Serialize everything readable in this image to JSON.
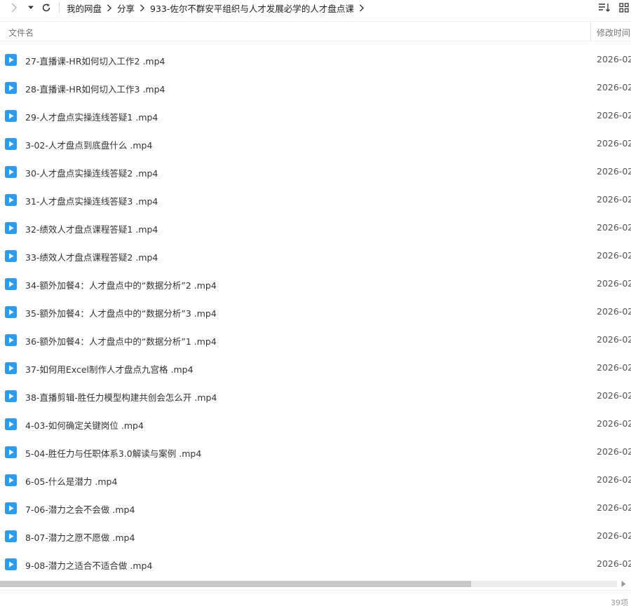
{
  "breadcrumb": {
    "items": [
      {
        "label": "我的网盘"
      },
      {
        "label": "分享"
      },
      {
        "label": "933-佐尔不群安平组织与人才发展必学的人才盘点课"
      }
    ]
  },
  "table": {
    "headers": {
      "name": "文件名",
      "modified": "修改时间"
    },
    "rows": [
      {
        "name": "27-直播课-HR如何切入工作2 .mp4",
        "date": "2026-02-"
      },
      {
        "name": "28-直播课-HR如何切入工作3 .mp4",
        "date": "2026-02-"
      },
      {
        "name": "29-人才盘点实操连线答疑1 .mp4",
        "date": "2026-02-"
      },
      {
        "name": "3-02-人才盘点到底盘什么 .mp4",
        "date": "2026-02-"
      },
      {
        "name": "30-人才盘点实操连线答疑2 .mp4",
        "date": "2026-02-"
      },
      {
        "name": "31-人才盘点实操连线答疑3 .mp4",
        "date": "2026-02-"
      },
      {
        "name": "32-绩效人才盘点课程答疑1 .mp4",
        "date": "2026-02-"
      },
      {
        "name": "33-绩效人才盘点课程答疑2 .mp4",
        "date": "2026-02-"
      },
      {
        "name": "34-额外加餐4：人才盘点中的“数据分析”2 .mp4",
        "date": "2026-02-"
      },
      {
        "name": "35-额外加餐4：人才盘点中的“数据分析”3 .mp4",
        "date": "2026-02-"
      },
      {
        "name": "36-额外加餐4：人才盘点中的“数据分析”1 .mp4",
        "date": "2026-02-"
      },
      {
        "name": "37-如何用Excel制作人才盘点九宫格 .mp4",
        "date": "2026-02-"
      },
      {
        "name": "38-直播剪辑-胜任力模型构建共创会怎么开 .mp4",
        "date": "2026-02-"
      },
      {
        "name": "4-03-如何确定关键岗位 .mp4",
        "date": "2026-02-"
      },
      {
        "name": "5-04-胜任力与任职体系3.0解读与案例 .mp4",
        "date": "2026-02-"
      },
      {
        "name": "6-05-什么是潜力 .mp4",
        "date": "2026-02-"
      },
      {
        "name": "7-06-潜力之会不会做 .mp4",
        "date": "2026-02-"
      },
      {
        "name": "8-07-潜力之愿不愿做 .mp4",
        "date": "2026-02-"
      },
      {
        "name": "9-08-潜力之适合不适合做 .mp4",
        "date": "2026-02-"
      }
    ]
  },
  "footer": {
    "count": "39项"
  },
  "colors": {
    "video_icon": "#2c9cf0",
    "scroll_thumb": "#c7c7c7"
  },
  "icons": {
    "forward": "chevron-right-icon",
    "history": "chevron-down-icon",
    "refresh": "refresh-icon",
    "sort": "sort-icon",
    "view": "grid-view-icon",
    "file": "video-file-icon"
  }
}
